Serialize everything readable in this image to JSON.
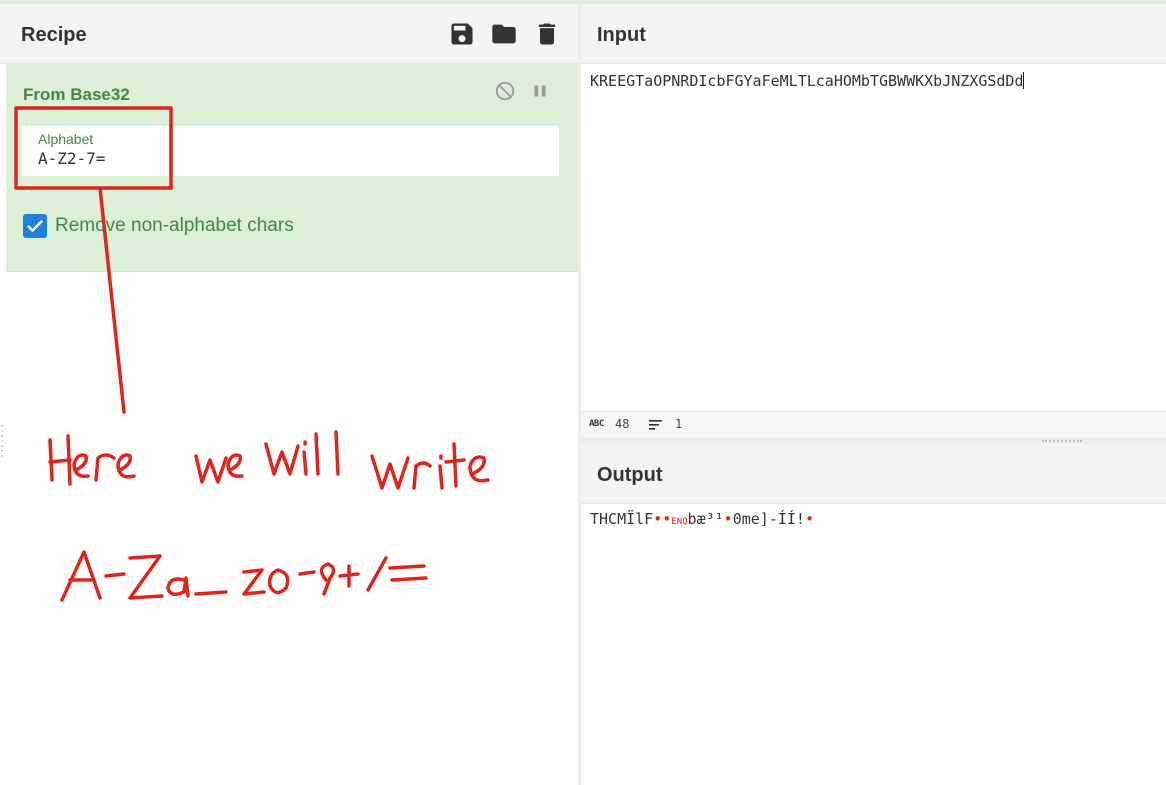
{
  "recipe": {
    "title": "Recipe",
    "icons": [
      "save-icon",
      "folder-icon",
      "trash-icon"
    ],
    "operation": {
      "name": "From Base32",
      "icons": [
        "disable-icon",
        "pause-icon"
      ],
      "alphabet_label": "Alphabet",
      "alphabet_value": "A-Z2-7=",
      "remove_checkbox_label": "Remove non-alphabet chars",
      "remove_checked": true
    }
  },
  "input": {
    "title": "Input",
    "text": "KREEGTaOPNRDIcbFGYaFeMLTLcaHOMbTGBWWKXbJNZXGSdDd",
    "length": "48",
    "lines": "1"
  },
  "output": {
    "title": "Output",
    "segments": {
      "a": "THCMÏlF",
      "b": "••",
      "c": "ENQ",
      "d": "bæ³¹",
      "e": "•",
      "f": "0me]-ÍÍ!",
      "g": "•"
    }
  },
  "annotation": {
    "line1": "Here we will write",
    "line2": "A-Za-z0-9+/="
  },
  "colors": {
    "accent_green": "#3f8a3f",
    "card_bg": "#dcefd7",
    "checkbox_blue": "#1f80dd",
    "annotation_red": "#e0251c"
  }
}
